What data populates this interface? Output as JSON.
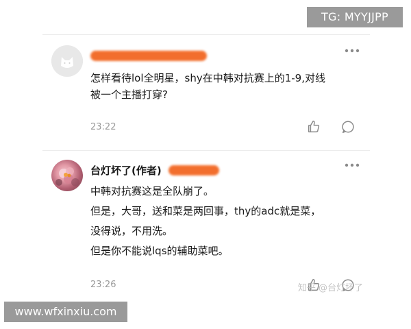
{
  "watermarks": {
    "top_right": "TG: MYYJJPP",
    "bottom_left": "www.wfxinxiu.com",
    "zhihu": "知乎 @台灯坏了"
  },
  "comments": [
    {
      "author": "",
      "author_tag": "",
      "avatar": "default-avatar-icon",
      "content_lines": [
        "怎样看待lol全明星，shy在中韩对抗赛上的1-9,对线",
        "被一个主播打穿?"
      ],
      "time": "23:22"
    },
    {
      "author": "台灯坏了",
      "author_tag": "(作者)",
      "avatar": "flower-avatar",
      "content_lines": [
        "中韩对抗赛这是全队崩了。",
        "但是，大哥，送和菜是两回事，thy的adc就是菜，",
        "没得说，不用洗。",
        "但是你不能说lqs的辅助菜吧。"
      ],
      "time": "23:26"
    }
  ],
  "icons": {
    "more": "more-icon",
    "like": "thumbs-up-icon",
    "reply": "reply-bubble-icon"
  },
  "colors": {
    "redaction": "#f26722",
    "text": "#1a1a1a",
    "meta": "#999999",
    "separator": "#ececec",
    "icon": "#8a8a8a"
  }
}
